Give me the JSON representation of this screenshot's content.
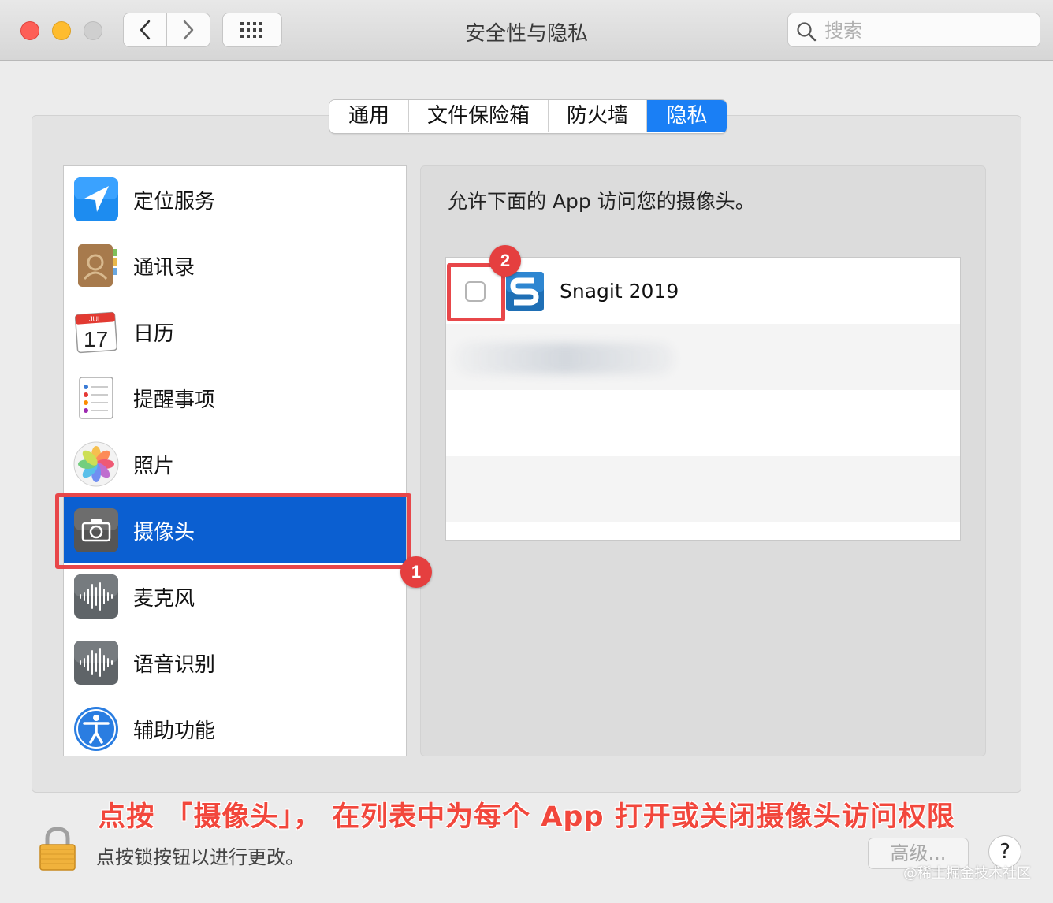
{
  "window": {
    "title": "安全性与隐私",
    "search_placeholder": "搜索",
    "traffic_lights": [
      "close",
      "minimize",
      "zoom"
    ]
  },
  "tabs": [
    {
      "label": "通用",
      "selected": false
    },
    {
      "label": "文件保险箱",
      "selected": false
    },
    {
      "label": "防火墙",
      "selected": false
    },
    {
      "label": "隐私",
      "selected": true
    }
  ],
  "sidebar": {
    "items": [
      {
        "label": "定位服务",
        "icon": "location-arrow-icon"
      },
      {
        "label": "通讯录",
        "icon": "contacts-book-icon"
      },
      {
        "label": "日历",
        "icon": "calendar-icon",
        "icon_month": "JUL",
        "icon_day": "17"
      },
      {
        "label": "提醒事项",
        "icon": "reminders-icon"
      },
      {
        "label": "照片",
        "icon": "photos-icon"
      },
      {
        "label": "摄像头",
        "icon": "camera-icon",
        "selected": true
      },
      {
        "label": "麦克风",
        "icon": "microphone-waveform-icon"
      },
      {
        "label": "语音识别",
        "icon": "speech-waveform-icon"
      },
      {
        "label": "辅助功能",
        "icon": "accessibility-icon"
      }
    ]
  },
  "content": {
    "heading": "允许下面的 App 访问您的摄像头。",
    "apps": [
      {
        "name": "Snagit 2019",
        "checked": false,
        "icon": "snagit-icon"
      }
    ]
  },
  "annotations": {
    "badge_1": "1",
    "badge_2": "2",
    "caption": "点按 「摄像头」， 在列表中为每个 App 打开或关闭摄像头访问权限"
  },
  "footer": {
    "lock_text": "点按锁按钮以进行更改。",
    "advanced_label": "高级...",
    "help_label": "?",
    "watermark": "@稀土掘金技术社区"
  },
  "colors": {
    "accent": "#1a7ff5",
    "selected_row": "#0b5fd1",
    "annotation_red": "#e8474a"
  }
}
